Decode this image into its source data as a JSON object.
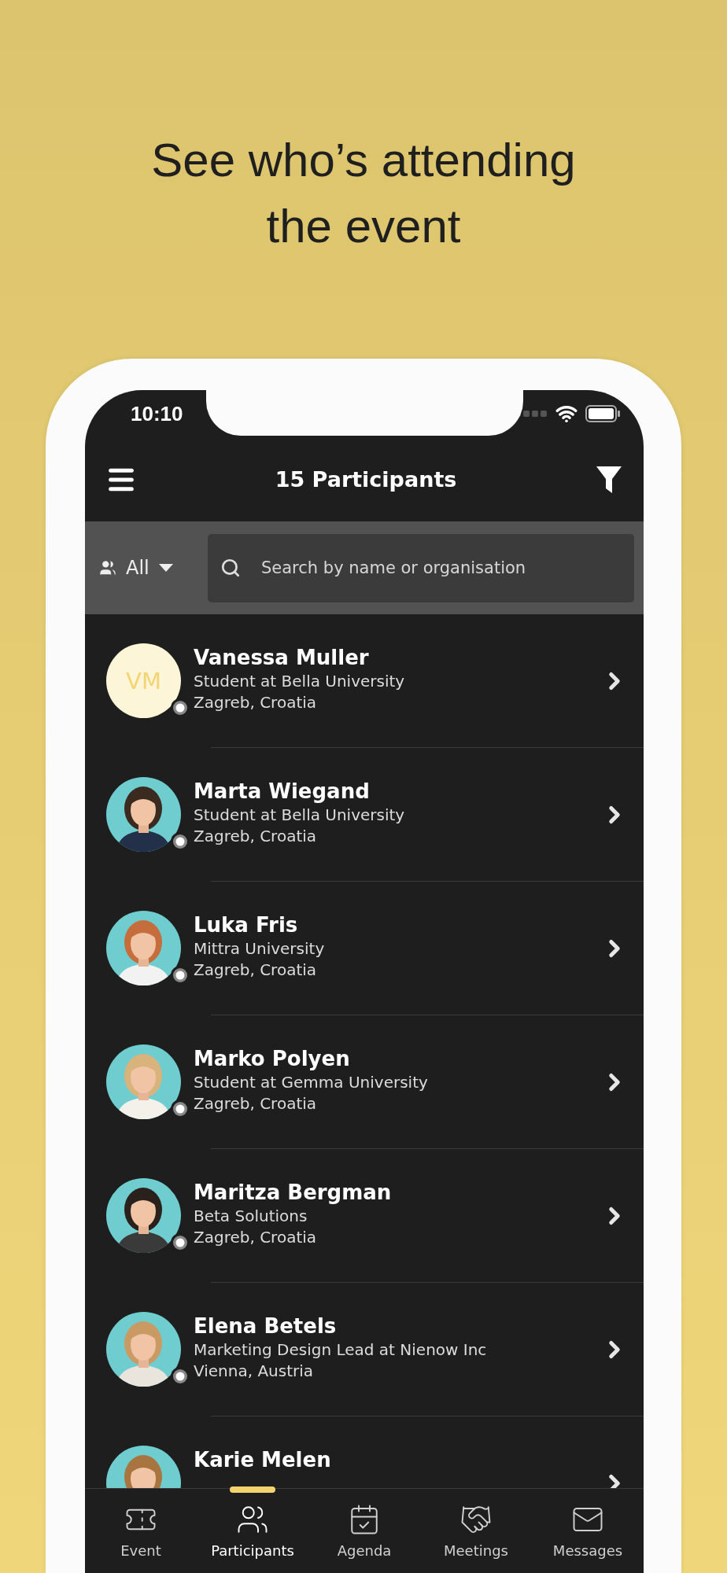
{
  "headline": "See who’s attending the event",
  "status_bar": {
    "time": "10:10"
  },
  "header": {
    "title": "15 Participants"
  },
  "filter_bar": {
    "group": "All",
    "search": {
      "placeholder": "Search by name or organisation"
    }
  },
  "participants": [
    {
      "kind": "initials",
      "online": false,
      "initials": "VM",
      "name": "Vanessa Muller",
      "organisation": "Student at Bella University",
      "location": "Zagreb, Croatia"
    },
    {
      "kind": "picture",
      "online": false,
      "name": "Marta Wiegand",
      "organisation": "Student at Bella University",
      "location": "Zagreb, Croatia"
    },
    {
      "kind": "picture",
      "online": false,
      "name": "Luka Fris",
      "organisation": "Mittra University",
      "location": "Zagreb, Croatia"
    },
    {
      "kind": "picture",
      "online": false,
      "name": "Marko Polyen",
      "organisation": "Student at Gemma University",
      "location": "Zagreb, Croatia"
    },
    {
      "kind": "picture",
      "online": false,
      "name": "Maritza Bergman",
      "organisation": "Beta Solutions",
      "location": "Zagreb, Croatia"
    },
    {
      "kind": "picture",
      "online": false,
      "name": "Elena Betels",
      "organisation": "Marketing Design Lead at Nienow Inc",
      "location": "Vienna, Austria"
    },
    {
      "kind": "picture",
      "name": "Karie Melen"
    }
  ],
  "tabs": [
    {
      "kind": "event",
      "label": "Event",
      "selected": false
    },
    {
      "kind": "participants",
      "label": "Participants",
      "selected": true
    },
    {
      "kind": "agenda",
      "label": "Agenda",
      "selected": false
    },
    {
      "kind": "meetings",
      "label": "Meetings",
      "selected": false
    },
    {
      "kind": "messages",
      "label": "Messages",
      "selected": false
    }
  ]
}
